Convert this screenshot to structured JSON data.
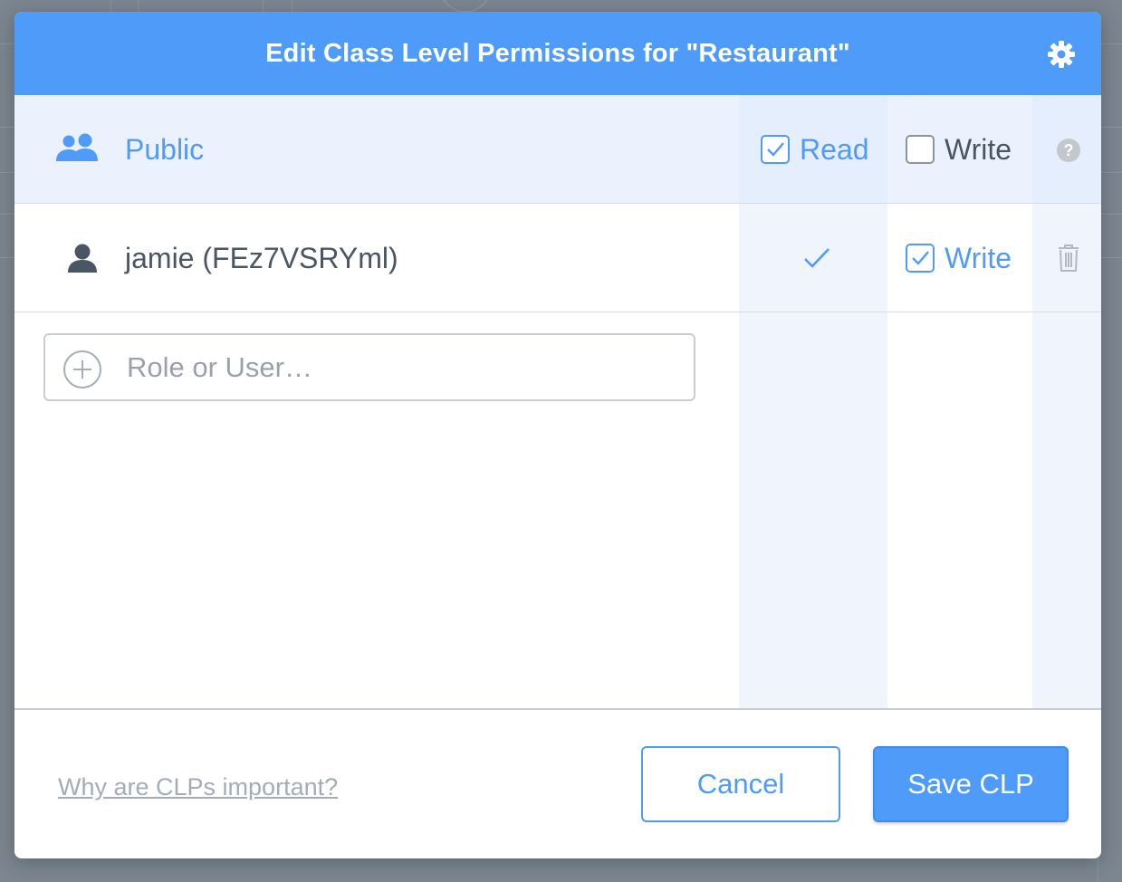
{
  "modal": {
    "title": "Edit Class Level Permissions for \"Restaurant\""
  },
  "rows": [
    {
      "name": "Public",
      "type": "group",
      "read": {
        "label": "Read",
        "checked": true
      },
      "write": {
        "label": "Write",
        "checked": false
      }
    },
    {
      "name": "jamie (FEz7VSRYml)",
      "type": "user",
      "read": {
        "checked": true
      },
      "write": {
        "label": "Write",
        "checked": true
      }
    }
  ],
  "add_entry": {
    "placeholder": "Role or User…"
  },
  "footer": {
    "help_link": "Why are CLPs important?",
    "cancel_label": "Cancel",
    "save_label": "Save CLP"
  },
  "icons": {
    "settings": "gear-icon",
    "public": "users-icon",
    "user": "user-icon",
    "help": "help-icon",
    "delete": "trash-icon",
    "add": "plus-circle-icon"
  },
  "colors": {
    "accent": "#4f9bfa",
    "text": "#4a5663",
    "muted": "#a5acb4"
  }
}
